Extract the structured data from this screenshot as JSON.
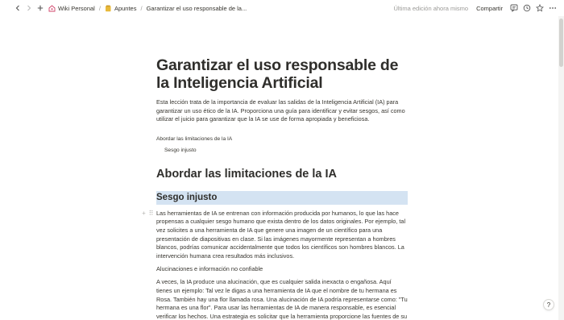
{
  "topbar": {
    "breadcrumbs": [
      {
        "label": "Wiki Personal",
        "icon": "wiki-icon"
      },
      {
        "label": "Apuntes",
        "icon": "folder-icon"
      },
      {
        "label": "Garantizar el uso responsable de la..."
      }
    ],
    "separator": "/",
    "edited": "Última edición ahora mismo",
    "share": "Compartir"
  },
  "page": {
    "title": "Garantizar el uso responsable de la Inteligencia Artificial",
    "intro": "Esta lección trata de la importancia de evaluar las salidas de la Inteligencia Artificial (IA) para garantizar un uso ético de la IA. Proporciona una guía para identificar y evitar sesgos, así como utilizar el juicio para garantizar que la IA se use de forma apropiada y beneficiosa.",
    "toc": [
      {
        "label": "Abordar las limitaciones de la IA"
      },
      {
        "label": "Sesgo injusto"
      }
    ],
    "h1": "Abordar las limitaciones de la IA",
    "h2": "Sesgo injusto",
    "para1": "Las herramientas de IA se entrenan con información producida por humanos, lo que las hace propensas a cualquier sesgo humano que exista dentro de los datos originales. Por ejemplo, tal vez solicites a una herramienta de IA que genere una imagen de un científico para una presentación de diapositivas en clase. Si las imágenes mayormente representan a hombres blancos, podrías comunicar accidentalmente que todos los científicos son hombres blancos. La intervención humana crea resultados más inclusivos.",
    "subhead": "Alucinaciones e información no confiable",
    "para2": "A veces, la IA produce una alucinación, que es cualquier salida inexacta o engañosa. Aquí tienes un ejemplo: Tal vez le digas a una herramienta de IA que el nombre de tu hermana es Rosa. También hay una flor llamada rosa. Una alucinación de IA podría representarse como: \"Tu hermana es una flor\". Para usar las herramientas de IA de manera responsable, es esencial verificar los hechos. Una estrategia es solicitar que la herramienta proporcione las fuentes de su"
  },
  "help": "?",
  "colors": {
    "highlight": "#d4e3f2",
    "text": "#37352f",
    "muted": "#9b9a97"
  }
}
